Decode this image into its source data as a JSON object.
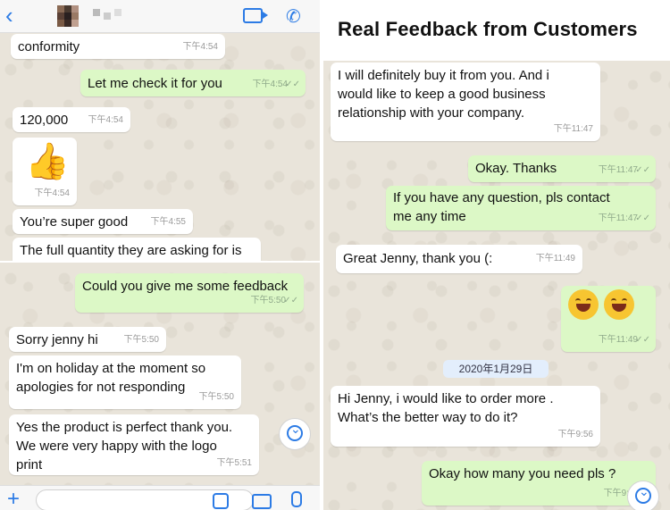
{
  "title": "Real Feedback from Customers",
  "panel1": {
    "m1": {
      "text": "conformity",
      "time": "下午4:54"
    },
    "m2": {
      "text": "Let me check it for you",
      "time": "下午4:54"
    },
    "m3": {
      "text": "120,000",
      "time": "下午4:54"
    },
    "m4": {
      "emoji": "👍",
      "time": "下午4:54"
    },
    "m5": {
      "text": "You’re super good",
      "time": "下午4:55"
    },
    "m6": {
      "text": "The full quantity they are asking for is"
    }
  },
  "panel2": {
    "m1": {
      "text": "Could you give me some feedback",
      "time": "下午5:50"
    },
    "m2": {
      "text": "Sorry jenny hi",
      "time": "下午5:50"
    },
    "m3": {
      "text": "I'm on holiday at the moment so\napologies for not responding",
      "time": "下午5:50"
    },
    "m4": {
      "text": "Yes the product is perfect thank you.\nWe were very happy with the logo\nprint",
      "time": "下午5:51"
    }
  },
  "panel3": {
    "m1": {
      "text": "I will definitely buy it from you. And i\nwould like to keep a good business\nrelationship with your company.",
      "time": "下午11:47"
    },
    "m2": {
      "text": "Okay. Thanks",
      "time": "下午11:47"
    },
    "m3": {
      "text": "If you have any question, pls contact\nme any time",
      "time": "下午11:47"
    },
    "m4": {
      "text": "Great Jenny, thank you (:",
      "time": "下午11:49"
    },
    "m5": {
      "time": "下午11:49"
    },
    "date": "2020年1月29日",
    "m6": {
      "text": "Hi Jenny, i would like to order more .\nWhat’s the better way to do it?",
      "time": "下午9:56"
    },
    "m7": {
      "text": "Okay how many you need pls ?",
      "time": "下午9:"
    }
  },
  "icons": {
    "back": "back-chevron-icon",
    "video": "video-camera-icon",
    "call": "phone-icon",
    "scroll": "scroll-down-icon",
    "attach": "plus-icon",
    "sticker": "sticker-icon",
    "camera": "camera-icon",
    "mic": "microphone-icon"
  },
  "colors": {
    "incoming": "#ffffff",
    "outgoing": "#dcf8c6",
    "accent": "#2c7be5",
    "read_tick": "#4fb3f0"
  }
}
